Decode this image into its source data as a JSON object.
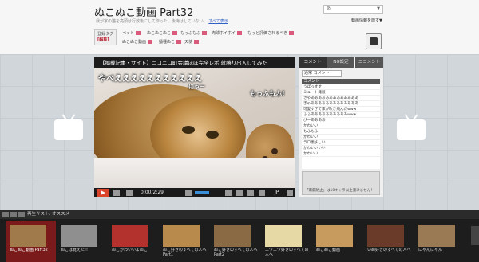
{
  "header": {
    "title": "ぬこぬこ動画 Part32",
    "description": "我が家の猫を亮頭は行放後にして作った、後悔はしていない。",
    "show_all_link": "すべて表示",
    "tag_label": "登録タグ",
    "tag_edit": "[編集]",
    "tags": [
      "ペット",
      "ぬこぬこぬこ",
      "もっふもふ",
      "肉球ホイホイ",
      "もっと評価されるべき",
      "ぬこぬこ動画",
      "播種ぬこ",
      "天使"
    ],
    "search_placeholder": "あ",
    "tv_info_link": "動画情報を隠す▼"
  },
  "player": {
    "title": "【揭載記事・サイト】ニコニコ町会議ほぼ完全レポ 就勝り出入してみた",
    "comments": [
      "やべえええええええええええ",
      "にゃー",
      "もっふもふ!"
    ],
    "time": "0:00/2:29",
    "lang": "JP"
  },
  "panel": {
    "tabs": [
      "コメント",
      "NG設定",
      "ニコメント"
    ],
    "sort": "通常 コメント",
    "list_header": "コメント",
    "comments": [
      "うぼっすす",
      "ミュート発展",
      "きゃあああああああああああああ",
      "ぎゃあああああああああああああ",
      "可愛すぎて家が吹き飛んだwww",
      "ふふああああああああああwww",
      "ぴーああああ",
      "かわいい",
      "もふもふ",
      "かわいい",
      "ラロ羨ましい",
      "かわいいいい",
      "かわいい"
    ],
    "input_hint": "「雨漏防止」は10キャラ以上書けません！"
  },
  "shelf": {
    "header": "再生リスト: オススメ",
    "items": [
      {
        "title": "ぬこぬこ動画 Part32",
        "color": "#a07a4a"
      },
      {
        "title": "ぬこは覚えた!!",
        "color": "#8f8f8f"
      },
      {
        "title": "ぬこかわいいよぬこ",
        "color": "#b3322d"
      },
      {
        "title": "ぬこ好きのすべての人へPart1",
        "color": "#b88a4c"
      },
      {
        "title": "ぬこ好きのすべての人へPart2",
        "color": "#8a6a45"
      },
      {
        "title": "ニワニワ好きのすべての人へ",
        "color": "#e7d9a6"
      },
      {
        "title": "ぬこぬこ動画",
        "color": "#c79a5d"
      },
      {
        "title": "いぬ好きのすべての人へ",
        "color": "#6b3b2a"
      },
      {
        "title": "にゃんにゃん",
        "color": "#9a7a55"
      }
    ]
  }
}
